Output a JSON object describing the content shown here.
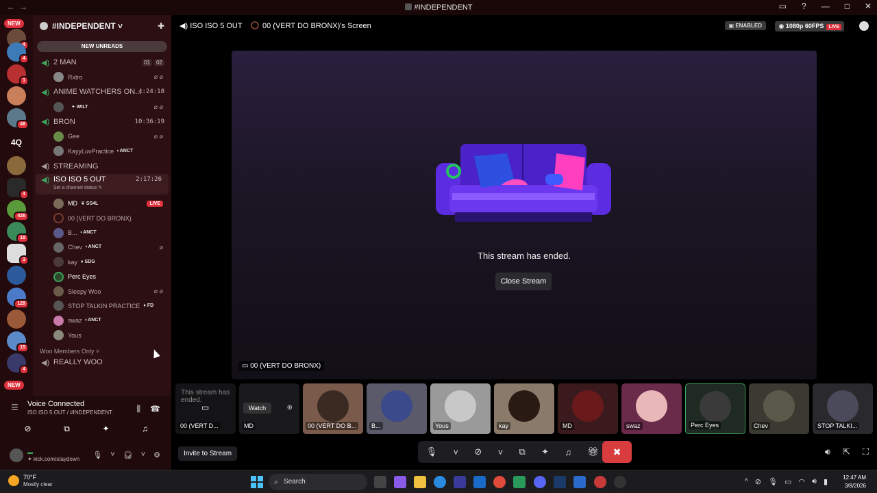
{
  "titlebar": {
    "title": "#INDEPENDENT",
    "back": "←",
    "forward": "→",
    "minimize": "—",
    "maximize": "□",
    "close": "✕"
  },
  "rail": {
    "new_top": "NEW",
    "new_bottom": "NEW",
    "text_server": "4Q",
    "badges": [
      "4",
      "4",
      "1",
      "48",
      "4",
      "426",
      "19",
      "3",
      "129",
      "15",
      "4"
    ]
  },
  "sidebar": {
    "guild_name": "#INDEPENDENT ˅",
    "new_unreads": "NEW UNREADS",
    "channels": [
      {
        "name": "2 MAN",
        "counts": [
          "01",
          "02"
        ],
        "users": [
          {
            "name": "Rxtro",
            "icons": "⌀ ⌀"
          }
        ]
      },
      {
        "name": "ANIME WATCHERS ON...",
        "time": "4:24:18",
        "users": [
          {
            "name": "",
            "tag": "✦ WILT",
            "icons": "⌀ ⌀"
          }
        ]
      },
      {
        "name": "BRON",
        "time": "10:36:19",
        "users": [
          {
            "name": "Gee",
            "icons": "⌀ ⌀"
          },
          {
            "name": "KayyLuvPractice",
            "tag": "⬫ ANCT"
          }
        ]
      },
      {
        "name": "STREAMING"
      }
    ],
    "active_channel": {
      "name": "ISO ISO 5 OUT",
      "time": "2:17:26",
      "status": "Set a channel status ✎",
      "users": [
        {
          "name": "MD",
          "tag": "❦ SS4L",
          "live": "LIVE"
        },
        {
          "name": "00 (VERT DO BRONX)"
        },
        {
          "name": "B...",
          "tag": "⬫ ANCT"
        },
        {
          "name": "Chev",
          "tag": "⬫ ANCT",
          "icons": "⌀"
        },
        {
          "name": "kay",
          "tag": "♦ SDG"
        },
        {
          "name": "Perc Eyes"
        },
        {
          "name": "Sleepy Woo",
          "icons": "⌀ ⌀"
        },
        {
          "name": "STOP TALKIN PRACTICE",
          "tag": "♦ FD"
        },
        {
          "name": "swaz",
          "tag": "⬫ ANCT"
        },
        {
          "name": "Yous"
        }
      ]
    },
    "category": "Woo Members Only ˅",
    "last_channel": "REALLY WOO"
  },
  "voice_panel": {
    "title": "Voice Connected",
    "subtitle": "ISO ISO 5 OUT / #INDEPENDENT",
    "username_status": "✦ kick.com/staydown"
  },
  "main": {
    "channel": "ISO ISO 5 OUT",
    "screen_title": "00 (VERT DO BRONX)'s Screen",
    "enabled": "ENABLED",
    "quality": "1080p 60FPS",
    "live": "LIVE",
    "stream_ended": "This stream has ended.",
    "close_stream": "Close Stream",
    "stage_label": "00 (VERT DO BRONX)",
    "invite": "Invite to Stream",
    "tiles": [
      {
        "label": "00 (VERT D...",
        "ended": "This stream has ended."
      },
      {
        "label": "MD",
        "watch": "Watch"
      },
      {
        "label": "00 (VERT DO B..."
      },
      {
        "label": "B..."
      },
      {
        "label": "Yous"
      },
      {
        "label": "kay"
      },
      {
        "label": "MD"
      },
      {
        "label": "swaz"
      },
      {
        "label": "Perc Eyes"
      },
      {
        "label": "Chev"
      },
      {
        "label": "STOP TALKI..."
      }
    ]
  },
  "taskbar": {
    "temp": "70°F",
    "weather": "Mostly clear",
    "search": "Search",
    "time": "12:47 AM",
    "date": "3/8/2026"
  },
  "colors": {
    "accent_red": "#e0303c",
    "voice_green": "#3ba55c",
    "hangup": "#d83c3e"
  }
}
